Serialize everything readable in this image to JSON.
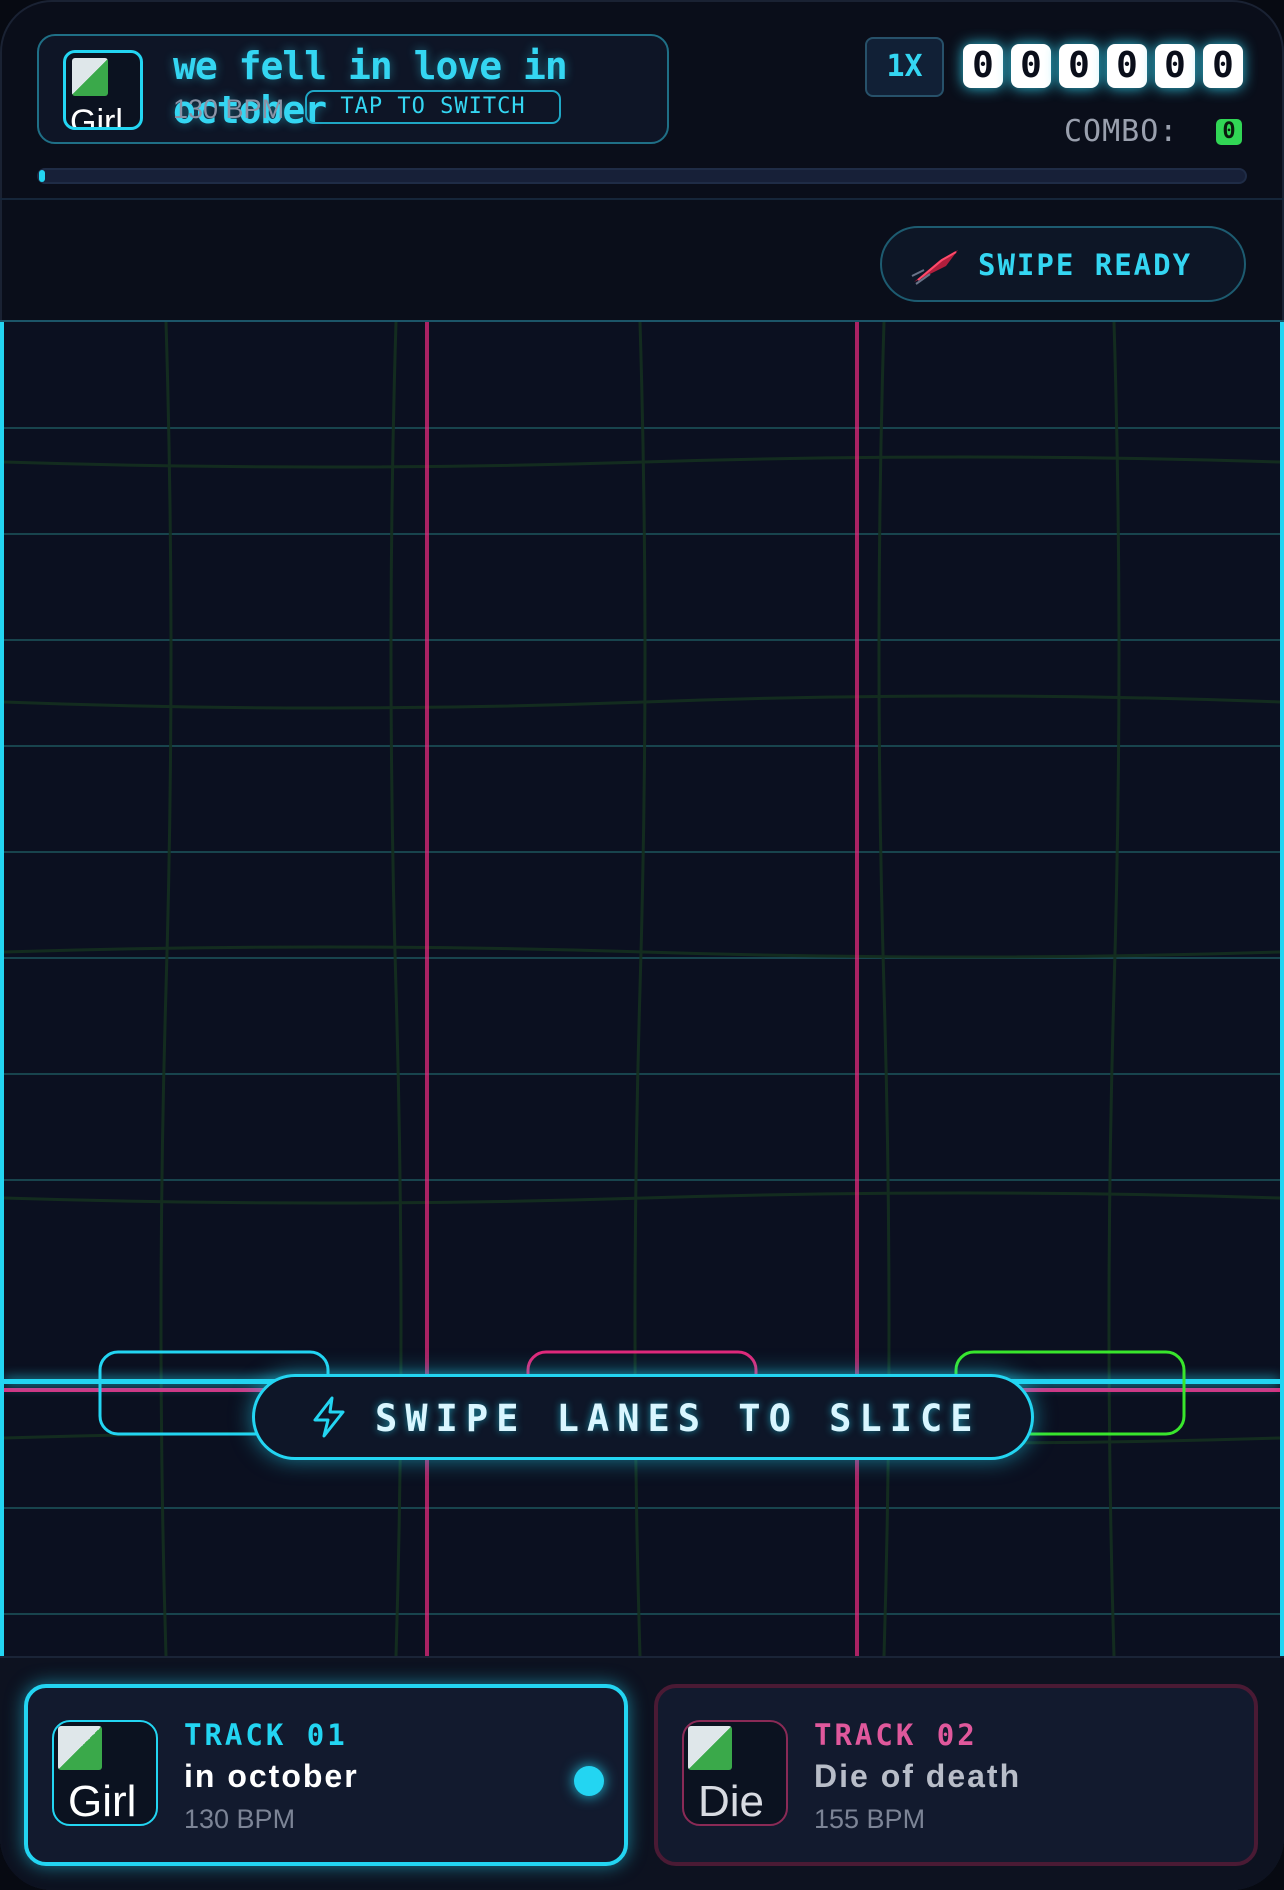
{
  "now_playing": {
    "title": "we fell in love in october",
    "bpm": "130 BPM",
    "cover_alt": "Girl",
    "switch_label": "TAP TO SWITCH"
  },
  "hud": {
    "multiplier": "1X",
    "score_digits": [
      "0",
      "0",
      "0",
      "0",
      "0",
      "0"
    ],
    "combo_label": "COMBO:",
    "combo_value": "0",
    "song_progress": 0.0
  },
  "swipe_status": {
    "label": "SWIPE READY",
    "icon": "blade-icon"
  },
  "playfield": {
    "lanes": 3,
    "lane_colors": [
      "#23d5f2",
      "#e0287a",
      "#39e62c"
    ],
    "hint": "SWIPE LANES TO SLICE",
    "hint_icon": "lightning-icon"
  },
  "tracks": [
    {
      "number": "TRACK 01",
      "name": "in october",
      "bpm": "130 BPM",
      "cover_alt": "Girl",
      "selected": true
    },
    {
      "number": "TRACK 02",
      "name": "Die of death",
      "bpm": "155 BPM",
      "cover_alt": "Die",
      "selected": false
    }
  ],
  "colors": {
    "accent": "#23d5f2",
    "magenta": "#e0287a",
    "green": "#39e62c",
    "background": "#0a0e1a"
  }
}
